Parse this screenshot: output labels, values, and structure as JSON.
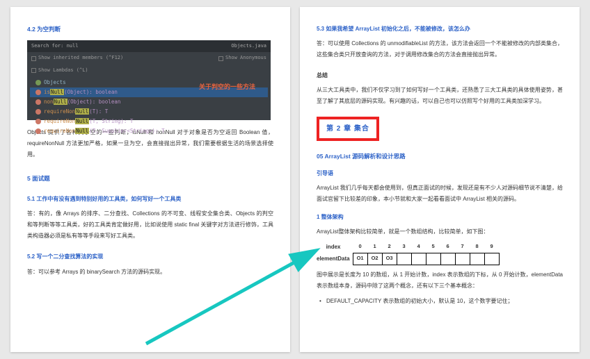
{
  "left": {
    "h42": "4.2 为空判断",
    "ide": {
      "search": "Search for: null",
      "objectsJava": "Objects.java",
      "inherited": "Show inherited members (^F12)",
      "lambdas": "Show Lambdas (^L)",
      "anon": "Show Anonymous",
      "node_objects": "Objects",
      "row1_a": "is",
      "row1_b": "Null",
      "row1_c": "(Object): boolean",
      "row2_a": "non",
      "row2_b": "Null",
      "row2_c": "(Object): boolean",
      "row3_a": "requireNon",
      "row3_b": "Null",
      "row3_c": "(T): T",
      "row4_a": "requireNon",
      "row4_b": "Null",
      "row4_c": "(T, String): T",
      "row5_a": "requireNon",
      "row5_b": "Null",
      "row5_c": "(T, Supplier<String>): T",
      "anno": "关于判空的一些方法"
    },
    "p_objects": "Objects 提供了各种关于空的一些判断，isNull 和 nonNull 对于对象是否为空返回 Boolean 值，requireNonNull 方法更加严格，如果一旦为空，会直接抛出异常，我们需要根据生活的场景选择使用。",
    "h5": "5 面试题",
    "h51": "5.1 工作中有没有遇到特别好用的工具类，如何写好一个工具类",
    "p51": "答：有的，像 Arrays 的排序、二分查找、Collections 的不可变、线程安全集合类、Objects 的判空和等判断等等工具类，好的工具类肯定做好用，比如说使用 static final 关键字对方法进行修饰，工具类构造器必须是私有等等手段来写好工具类。",
    "h52": "5.2 写一个二分查找算法的实现",
    "p52": "答：可以参考 Arrays 的 binarySearch 方法的源码实现。"
  },
  "right": {
    "h53": "5.3 如果我希望 ArrayList 初始化之后，不能被修改，该怎么办",
    "p53": "答：可以使用 Collections 的 unmodifiableList 的方法，该方法会返回一个不能被修改的内部类集合，这些集合类只开放查询的方法，对于调用修改集合的方法会直接抛出异常。",
    "h_summary": "总结",
    "p_summary": "从三大工具类中，我们不仅学习到了如何写好一个工具类，还熟悉了三大工具类的具体使用姿势，甚至了解了其底层的源码实现。有兴趣的话，可以自己也可以仿照写个好用的工具类加深学习。",
    "chapter2": "第 2 章 集合",
    "h05": "05 ArrayList 源码解析和设计思路",
    "h_intro": "引导语",
    "p_intro": "ArrayList 我们几乎每天都会使用到，但真正面试的时候，发现还是有不少人对源码细节说不清楚，给面试官留下比较差的印象，本小节就和大家一起看看面试中 ArrayList 相关的源码。",
    "h_arch": "1 整体架构",
    "p_arch": "ArrayList整体架构比较简单，就是一个数组结构，比较简单，如下图：",
    "arr": {
      "index_label": "index",
      "element_label": "elementData",
      "indices": [
        "0",
        "1",
        "2",
        "3",
        "4",
        "5",
        "6",
        "7",
        "8",
        "9"
      ],
      "cells": [
        "O1",
        "O2",
        "O3",
        "",
        "",
        "",
        "",
        "",
        "",
        ""
      ]
    },
    "p_arr_note": "图中展示是长度为 10 的数组，从 1 开始计数，index 表示数组的下标，从 0 开始计数，elementData 表示数组本身，源码中除了这两个概念，还有以下三个基本概念：",
    "bullet1": "DEFAULT_CAPACITY 表示数组的初始大小，默认是 10，这个数字要记住；"
  }
}
